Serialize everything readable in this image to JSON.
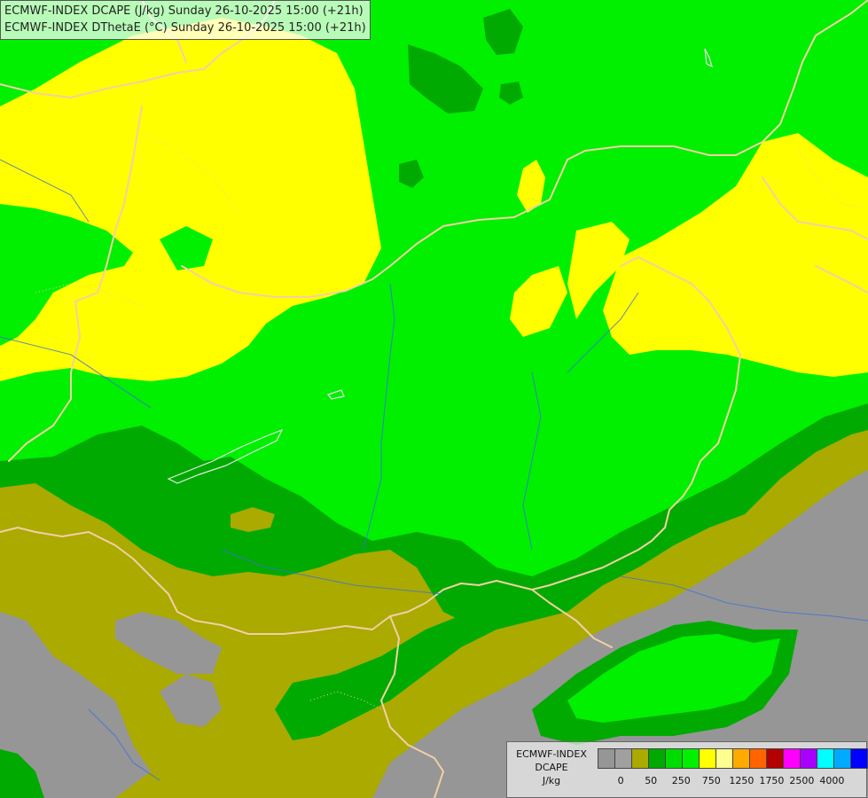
{
  "header": {
    "line1": "ECMWF-INDEX DCAPE (J/kg) Sunday 26-10-2025 15:00 (+21h)",
    "line2": "ECMWF-INDEX DThetaE (°C) Sunday 26-10-2025 15:00 (+21h)"
  },
  "legend": {
    "line1": "ECMWF-INDEX",
    "line2": "DCAPE",
    "line3": "J/kg",
    "colors": [
      "#969696",
      "#a0a0a0",
      "#aaaa00",
      "#00aa00",
      "#00dc00",
      "#00f000",
      "#ffff00",
      "#ffff90",
      "#ffaa00",
      "#ff6400",
      "#b40000",
      "#ff00ff",
      "#aa00ff",
      "#00ffff",
      "#00aaff",
      "#0000ff",
      "#000096"
    ],
    "tick_labels": [
      "0",
      "50",
      "250",
      "750",
      "1250",
      "1750",
      "2500",
      "4000"
    ]
  },
  "map_colors": {
    "lt_50": "#969696",
    "50_100": "#aaaa00",
    "100_200": "#00aa00",
    "200_300": "#00f000",
    "300_500": "#ffff00",
    "border": "#f2d0a4",
    "river": "#3c6edc"
  }
}
